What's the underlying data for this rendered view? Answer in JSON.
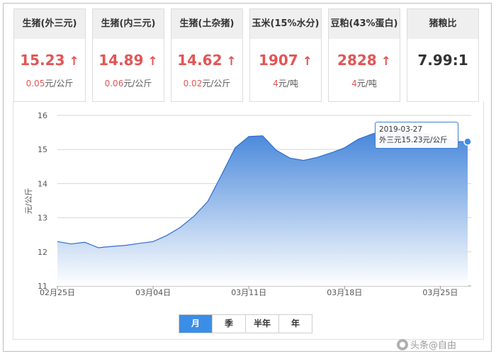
{
  "cards": [
    {
      "title": "生猪(外三元)",
      "price": "15.23",
      "arrow": "↑",
      "change": "0.05元/公斤",
      "has_arrow": true
    },
    {
      "title": "生猪(内三元)",
      "price": "14.89",
      "arrow": "↑",
      "change": "0.06元/公斤",
      "has_arrow": true
    },
    {
      "title": "生猪(土杂猪)",
      "price": "14.62",
      "arrow": "↑",
      "change": "0.02元/公斤",
      "has_arrow": true
    },
    {
      "title": "玉米(15%水分)",
      "price": "1907",
      "arrow": "↑",
      "change": "4元/吨",
      "has_arrow": true
    },
    {
      "title": "豆粕(43%蛋白)",
      "price": "2828",
      "arrow": "↑",
      "change": "4元/吨",
      "has_arrow": true
    },
    {
      "title": "猪粮比",
      "price": "7.99:1",
      "arrow": "",
      "change": "",
      "has_arrow": false
    }
  ],
  "tooltip": {
    "date": "2019-03-27",
    "value": "外三元15.23元/公斤"
  },
  "range_tabs": [
    {
      "label": "月",
      "active": true
    },
    {
      "label": "季",
      "active": false
    },
    {
      "label": "半年",
      "active": false
    },
    {
      "label": "年",
      "active": false
    }
  ],
  "watermark": "头条@自由",
  "colors": {
    "accent": "#3b8ee6",
    "up": "#e25555",
    "area_top": "#3b7fd8",
    "area_bottom": "#ffffff"
  },
  "chart_data": {
    "type": "area",
    "ylabel": "元/公斤",
    "ylim": [
      11,
      16
    ],
    "yticks": [
      11,
      12,
      13,
      14,
      15,
      16
    ],
    "xlim": [
      "2019-02-25",
      "2019-03-27"
    ],
    "xticks": [
      {
        "date": "2019-02-25",
        "label": "02月25日"
      },
      {
        "date": "2019-03-04",
        "label": "03月04日"
      },
      {
        "date": "2019-03-11",
        "label": "03月11日"
      },
      {
        "date": "2019-03-18",
        "label": "03月18日"
      },
      {
        "date": "2019-03-25",
        "label": "03月25日"
      }
    ],
    "grid": true,
    "series": [
      {
        "name": "外三元",
        "points": [
          [
            "2019-02-25",
            12.3
          ],
          [
            "2019-02-26",
            12.23
          ],
          [
            "2019-02-27",
            12.28
          ],
          [
            "2019-02-28",
            12.12
          ],
          [
            "2019-03-01",
            12.16
          ],
          [
            "2019-03-02",
            12.19
          ],
          [
            "2019-03-03",
            12.25
          ],
          [
            "2019-03-04",
            12.3
          ],
          [
            "2019-03-05",
            12.48
          ],
          [
            "2019-03-06",
            12.72
          ],
          [
            "2019-03-07",
            13.05
          ],
          [
            "2019-03-08",
            13.48
          ],
          [
            "2019-03-09",
            14.25
          ],
          [
            "2019-03-10",
            15.05
          ],
          [
            "2019-03-11",
            15.38
          ],
          [
            "2019-03-12",
            15.4
          ],
          [
            "2019-03-13",
            14.98
          ],
          [
            "2019-03-14",
            14.75
          ],
          [
            "2019-03-15",
            14.68
          ],
          [
            "2019-03-16",
            14.77
          ],
          [
            "2019-03-17",
            14.9
          ],
          [
            "2019-03-18",
            15.05
          ],
          [
            "2019-03-19",
            15.3
          ],
          [
            "2019-03-20",
            15.45
          ],
          [
            "2019-03-21",
            15.56
          ],
          [
            "2019-03-22",
            15.58
          ],
          [
            "2019-03-23",
            15.52
          ],
          [
            "2019-03-24",
            15.46
          ],
          [
            "2019-03-25",
            15.36
          ],
          [
            "2019-03-26",
            15.23
          ],
          [
            "2019-03-27",
            15.23
          ]
        ]
      }
    ],
    "highlight": {
      "date": "2019-03-27",
      "value": 15.23
    }
  }
}
